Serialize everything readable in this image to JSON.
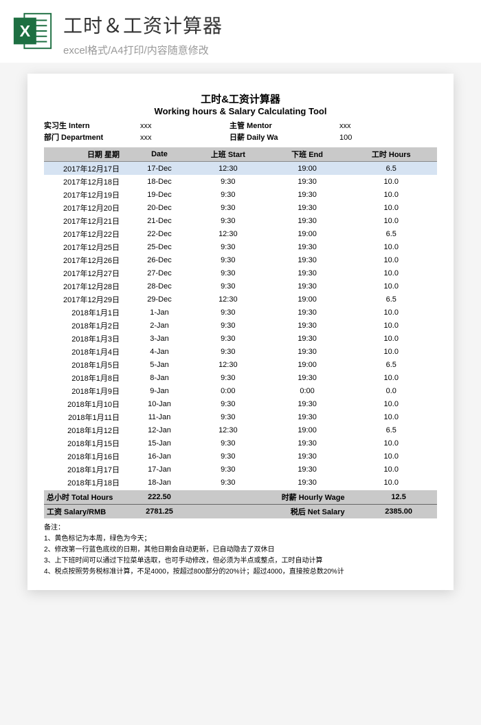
{
  "header": {
    "title": "工时＆工资计算器",
    "subtitle": "excel格式/A4打印/内容随意修改"
  },
  "doc": {
    "title_cn": "工时&工资计算器",
    "title_en": "Working hours & Salary Calculating Tool",
    "intern_label": "实习生 Intern",
    "intern_value": "xxx",
    "mentor_label": "主管 Mentor",
    "mentor_value": "xxx",
    "dept_label": "部门 Department",
    "dept_value": "xxx",
    "daily_label": "日薪 Daily Wa",
    "daily_value": "100"
  },
  "columns": {
    "date_cn": "日期 星期",
    "date_en": "Date",
    "start": "上班 Start",
    "end": "下班 End",
    "hours": "工时 Hours"
  },
  "rows": [
    {
      "cn": "2017年12月17日",
      "en": "17-Dec",
      "start": "12:30",
      "end": "19:00",
      "hours": "6.5",
      "blue": true
    },
    {
      "cn": "2017年12月18日",
      "en": "18-Dec",
      "start": "9:30",
      "end": "19:30",
      "hours": "10.0"
    },
    {
      "cn": "2017年12月19日",
      "en": "19-Dec",
      "start": "9:30",
      "end": "19:30",
      "hours": "10.0"
    },
    {
      "cn": "2017年12月20日",
      "en": "20-Dec",
      "start": "9:30",
      "end": "19:30",
      "hours": "10.0"
    },
    {
      "cn": "2017年12月21日",
      "en": "21-Dec",
      "start": "9:30",
      "end": "19:30",
      "hours": "10.0"
    },
    {
      "cn": "2017年12月22日",
      "en": "22-Dec",
      "start": "12:30",
      "end": "19:00",
      "hours": "6.5"
    },
    {
      "cn": "2017年12月25日",
      "en": "25-Dec",
      "start": "9:30",
      "end": "19:30",
      "hours": "10.0"
    },
    {
      "cn": "2017年12月26日",
      "en": "26-Dec",
      "start": "9:30",
      "end": "19:30",
      "hours": "10.0"
    },
    {
      "cn": "2017年12月27日",
      "en": "27-Dec",
      "start": "9:30",
      "end": "19:30",
      "hours": "10.0"
    },
    {
      "cn": "2017年12月28日",
      "en": "28-Dec",
      "start": "9:30",
      "end": "19:30",
      "hours": "10.0"
    },
    {
      "cn": "2017年12月29日",
      "en": "29-Dec",
      "start": "12:30",
      "end": "19:00",
      "hours": "6.5"
    },
    {
      "cn": "2018年1月1日",
      "en": "1-Jan",
      "start": "9:30",
      "end": "19:30",
      "hours": "10.0"
    },
    {
      "cn": "2018年1月2日",
      "en": "2-Jan",
      "start": "9:30",
      "end": "19:30",
      "hours": "10.0"
    },
    {
      "cn": "2018年1月3日",
      "en": "3-Jan",
      "start": "9:30",
      "end": "19:30",
      "hours": "10.0"
    },
    {
      "cn": "2018年1月4日",
      "en": "4-Jan",
      "start": "9:30",
      "end": "19:30",
      "hours": "10.0"
    },
    {
      "cn": "2018年1月5日",
      "en": "5-Jan",
      "start": "12:30",
      "end": "19:00",
      "hours": "6.5"
    },
    {
      "cn": "2018年1月8日",
      "en": "8-Jan",
      "start": "9:30",
      "end": "19:30",
      "hours": "10.0"
    },
    {
      "cn": "2018年1月9日",
      "en": "9-Jan",
      "start": "0:00",
      "end": "0:00",
      "hours": "0.0"
    },
    {
      "cn": "2018年1月10日",
      "en": "10-Jan",
      "start": "9:30",
      "end": "19:30",
      "hours": "10.0"
    },
    {
      "cn": "2018年1月11日",
      "en": "11-Jan",
      "start": "9:30",
      "end": "19:30",
      "hours": "10.0"
    },
    {
      "cn": "2018年1月12日",
      "en": "12-Jan",
      "start": "12:30",
      "end": "19:00",
      "hours": "6.5"
    },
    {
      "cn": "2018年1月15日",
      "en": "15-Jan",
      "start": "9:30",
      "end": "19:30",
      "hours": "10.0"
    },
    {
      "cn": "2018年1月16日",
      "en": "16-Jan",
      "start": "9:30",
      "end": "19:30",
      "hours": "10.0"
    },
    {
      "cn": "2018年1月17日",
      "en": "17-Jan",
      "start": "9:30",
      "end": "19:30",
      "hours": "10.0"
    },
    {
      "cn": "2018年1月18日",
      "en": "18-Jan",
      "start": "9:30",
      "end": "19:30",
      "hours": "10.0"
    }
  ],
  "totals": {
    "total_hours_label": "总小时 Total Hours",
    "total_hours_value": "222.50",
    "hourly_label": "时薪 Hourly Wage",
    "hourly_value": "12.5",
    "salary_label": "工资 Salary/RMB",
    "salary_value": "2781.25",
    "net_label": "税后 Net Salary",
    "net_value": "2385.00"
  },
  "notes": {
    "title": "备注：",
    "n1": "1、黄色标记为本周，绿色为今天；",
    "n2": "2、修改第一行蓝色底纹的日期，其他日期会自动更新，已自动隐去了双休日",
    "n3": "3、上下班时间可以通过下拉菜单选取，也可手动修改，但必须为半点或整点，工时自动计算",
    "n4": "4、税点按照劳务税标准计算，不足4000，按超过800部分的20%计；超过4000，直接按总数20%计"
  }
}
